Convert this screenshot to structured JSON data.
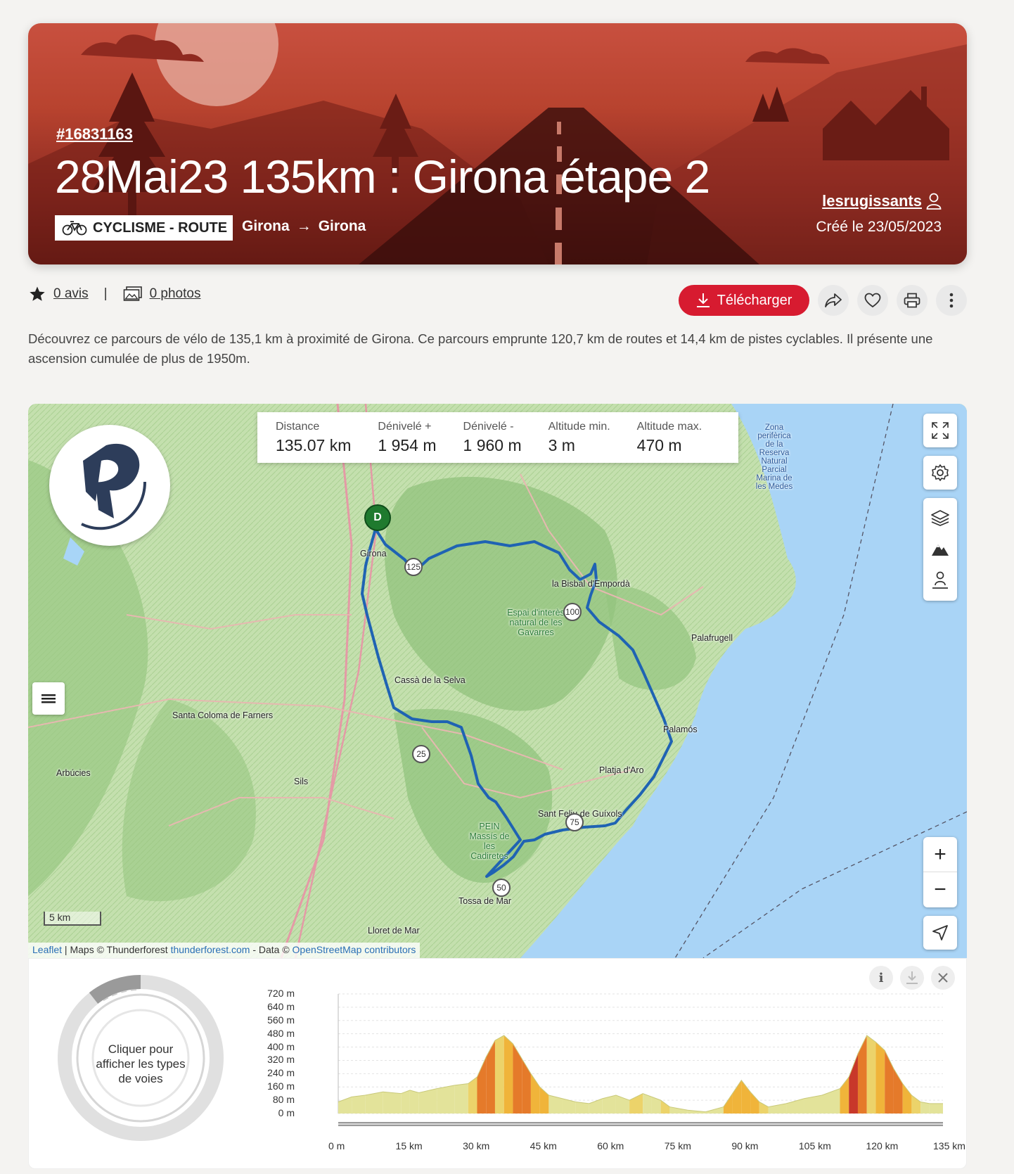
{
  "hero": {
    "id": "#16831163",
    "title": "28Mai23 135km : Girona étape 2",
    "activity": "CYCLISME - ROUTE",
    "from": "Girona",
    "arrow": "→",
    "to": "Girona",
    "author": "lesrugissants",
    "created": "Créé le 23/05/2023"
  },
  "meta": {
    "reviews": "0 avis",
    "separator": "|",
    "photos": "0 photos"
  },
  "actions": {
    "download": "Télécharger"
  },
  "description": "Découvrez ce parcours de vélo de 135,1 km à proximité de Girona. Ce parcours emprunte 120,7 km de routes et 14,4 km de pistes cyclables. Il présente une ascension cumulée de plus de 1950m.",
  "map": {
    "stats": [
      {
        "label": "Distance",
        "value": "135.07 km"
      },
      {
        "label": "Dénivelé +",
        "value": "1 954 m"
      },
      {
        "label": "Dénivelé -",
        "value": "1 960 m"
      },
      {
        "label": "Altitude min.",
        "value": "3 m"
      },
      {
        "label": "Altitude max.",
        "value": "470 m"
      }
    ],
    "start_marker": "D",
    "km_markers": [
      "125",
      "100",
      "25",
      "75",
      "50"
    ],
    "places": {
      "girona": "Girona",
      "bisbal": "la Bisbal d'Empordà",
      "palafrugell": "Palafrugell",
      "cassa": "Cassà de la Selva",
      "santa_coloma": "Santa Coloma de Farners",
      "palamos": "Palamós",
      "platja": "Platja d'Aro",
      "sant_feliu": "Sant Feliu de Guíxols",
      "arbucies": "Arbúcies",
      "sils": "Sils",
      "tossa": "Tossa de Mar",
      "lloret": "Lloret de Mar",
      "espai": "Espai d'interès natural de les Gavarres",
      "pein": "PEIN Massís de les Cadiretes",
      "zona": "Zona perifèrica de la Reserva Natural Parcial Marina de les Medes"
    },
    "scale": "5 km",
    "attribution": {
      "leaflet": "Leaflet",
      "maps": " | Maps © Thunderforest ",
      "tf_link": "thunderforest.com",
      "data": " - Data © ",
      "osm_link": "OpenStreetMap contributors"
    },
    "zoom_in": "+",
    "zoom_out": "−"
  },
  "elevation": {
    "donut_text": "Cliquer pour afficher les types de voies",
    "y_ticks": [
      "720 m",
      "640 m",
      "560 m",
      "480 m",
      "400 m",
      "320 m",
      "240 m",
      "160 m",
      "80 m",
      "0 m"
    ],
    "x_ticks": [
      "0 m",
      "15 km",
      "30 km",
      "45 km",
      "60 km",
      "75 km",
      "90 km",
      "105 km",
      "120 km",
      "135 km"
    ],
    "info_icon": "i"
  },
  "chart_data": {
    "type": "area",
    "xlabel": "",
    "ylabel": "",
    "xlim": [
      0,
      135
    ],
    "ylim": [
      0,
      720
    ],
    "x_unit": "km",
    "y_unit": "m",
    "series": [
      {
        "x": [
          0,
          3,
          6,
          10,
          14,
          16,
          18,
          22,
          26,
          29,
          31,
          33,
          35,
          37,
          39,
          41,
          43,
          45,
          47,
          50,
          53,
          56,
          59,
          62,
          65,
          68,
          70,
          72,
          74,
          78,
          82,
          86,
          88,
          90,
          92,
          94,
          96,
          100,
          104,
          108,
          112,
          114,
          116,
          118,
          120,
          122,
          124,
          126,
          128,
          130,
          132,
          135
        ],
        "y": [
          70,
          100,
          110,
          130,
          120,
          140,
          125,
          150,
          170,
          180,
          220,
          340,
          440,
          470,
          420,
          330,
          240,
          160,
          110,
          90,
          70,
          60,
          90,
          110,
          80,
          120,
          100,
          80,
          40,
          20,
          10,
          40,
          120,
          200,
          130,
          70,
          40,
          60,
          90,
          110,
          150,
          220,
          360,
          470,
          430,
          380,
          270,
          180,
          110,
          70,
          60,
          60
        ]
      }
    ]
  }
}
